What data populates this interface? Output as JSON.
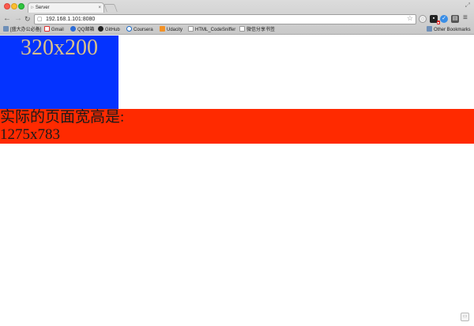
{
  "browser": {
    "tab_title": "Server",
    "tab_favicon": "ᐅ",
    "tab_close": "×",
    "url": "192.168.1.101:8080",
    "nav": {
      "back": "←",
      "forward": "→",
      "reload": "↻"
    },
    "menu": "≡",
    "bookmarks": [
      {
        "label": "[盛大办公必备]",
        "icon": "folder-icon",
        "cls": "folder"
      },
      {
        "label": "Gmail",
        "icon": "gmail-icon",
        "cls": "gmail"
      },
      {
        "label": "QQ邮箱",
        "icon": "qq-icon",
        "cls": "qq"
      },
      {
        "label": "GitHub",
        "icon": "github-icon",
        "cls": "github"
      },
      {
        "label": "Coursera",
        "icon": "coursera-icon",
        "cls": "coursera"
      },
      {
        "label": "Udacity",
        "icon": "udacity-icon",
        "cls": "udacity"
      },
      {
        "label": "HTML_CodeSniffer",
        "icon": "page-icon",
        "cls": "doc"
      },
      {
        "label": "微信分享书签",
        "icon": "page-icon",
        "cls": "doc"
      }
    ],
    "other_bookmarks": "Other Bookmarks"
  },
  "page": {
    "box_label": "320x200",
    "size_heading": "实际的页面宽高是:",
    "size_value": "1275x783"
  },
  "colors": {
    "box": "#0433ff",
    "bar": "#ff2a00"
  }
}
